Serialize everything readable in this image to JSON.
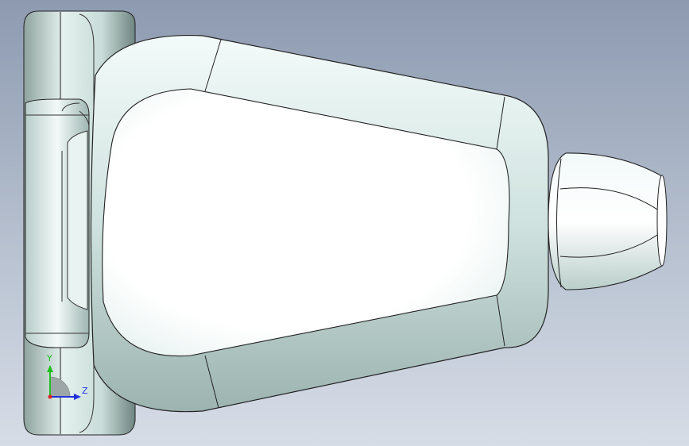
{
  "viewport": {
    "background_top": "#8d9ab0",
    "background_bottom": "#d7dde7"
  },
  "model": {
    "body_color": "#dfeeed",
    "edge_color": "#1a1a1a"
  },
  "triad": {
    "y_label": "Y",
    "z_label": "Z",
    "y_color": "#1fbf1f",
    "z_color": "#2233dd"
  }
}
